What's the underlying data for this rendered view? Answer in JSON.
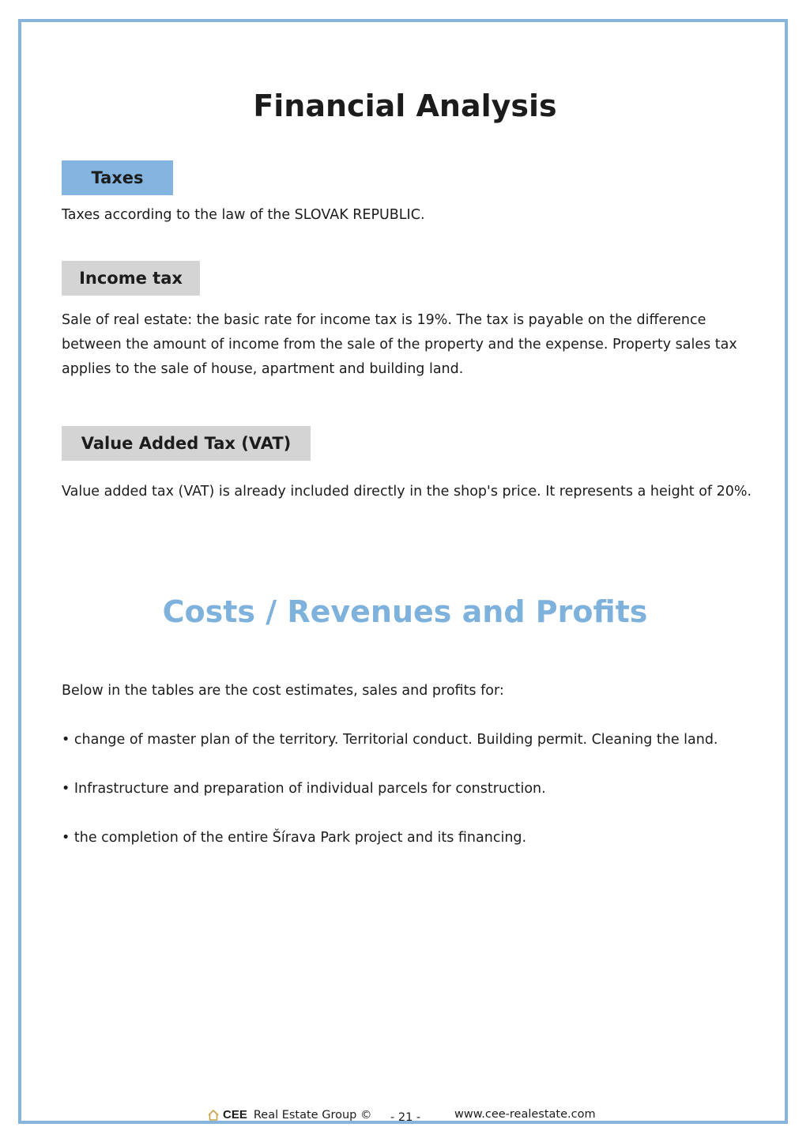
{
  "page": {
    "title": "Financial Analysis",
    "subtitle": "Costs / Revenues and Profits"
  },
  "taxes": {
    "label": "Taxes",
    "text": "Taxes according to the law of the SLOVAK REPUBLIC."
  },
  "income_tax": {
    "label": "Income tax",
    "text": "Sale of real estate: the basic rate for income tax is 19%. The tax is payable on the difference between the amount of income from the sale of the property and the expense. Property sales tax applies to the sale of house, apartment and building land."
  },
  "vat": {
    "label": "Value Added Tax (VAT)",
    "text": "Value added tax (VAT) is already included directly in the shop's price. It represents a height of 20%."
  },
  "costs": {
    "intro": "Below in the tables are the cost estimates, sales and profits for:",
    "bullets": [
      "• change of master plan of the territory. Territorial conduct. Building permit. Cleaning the land.",
      "• Infrastructure and preparation of individual parcels for construction.",
      "• the completion of the entire Šírava Park project and its financing."
    ]
  },
  "footer": {
    "logo_icon": "house-icon",
    "brand_short": "CEE",
    "brand_rest": "Real Estate Group ©",
    "page_number": "- 21 -",
    "website": "www.cee-realestate.com"
  },
  "colors": {
    "frame": "#86b4dc",
    "label_blue": "#84b4e0",
    "label_grey": "#d4d4d4",
    "subtitle": "#7eb2dc"
  }
}
